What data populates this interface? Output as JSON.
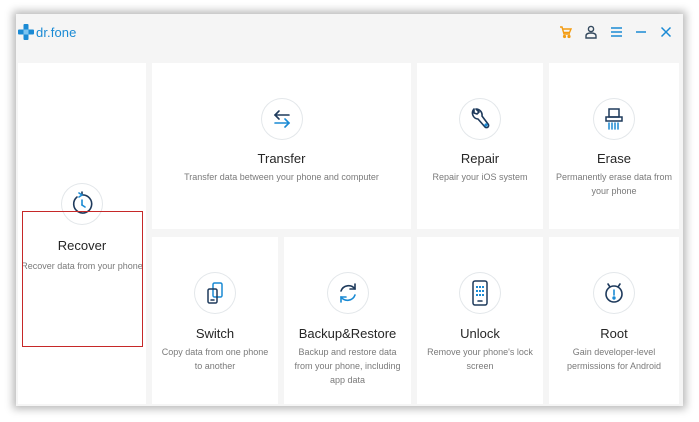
{
  "app": {
    "logo_text": "dr.fone",
    "brand_color": "#1a8ad4",
    "cart_color": "#f39c12"
  },
  "titlebar_icons": [
    "cart-icon",
    "user-icon",
    "menu-icon",
    "minimize-icon",
    "close-icon"
  ],
  "cards": {
    "recover": {
      "title": "Recover",
      "desc": "Recover data from your phone",
      "icon": "clock-icon",
      "selected": true
    },
    "transfer": {
      "title": "Transfer",
      "desc": "Transfer data between your phone and computer",
      "icon": "transfer-arrows-icon"
    },
    "repair": {
      "title": "Repair",
      "desc": "Repair your iOS system",
      "icon": "wrench-icon"
    },
    "erase": {
      "title": "Erase",
      "desc": "Permanently erase data from your phone",
      "icon": "shredder-icon"
    },
    "switch": {
      "title": "Switch",
      "desc": "Copy data from one phone to another",
      "icon": "phone-switch-icon"
    },
    "backup": {
      "title": "Backup&Restore",
      "desc": "Backup and restore data from your phone, including app data",
      "icon": "sync-icon"
    },
    "unlock": {
      "title": "Unlock",
      "desc": "Remove your phone's lock screen",
      "icon": "phone-keypad-icon"
    },
    "root": {
      "title": "Root",
      "desc": "Gain developer-level permissions for Android",
      "icon": "android-root-icon"
    }
  }
}
